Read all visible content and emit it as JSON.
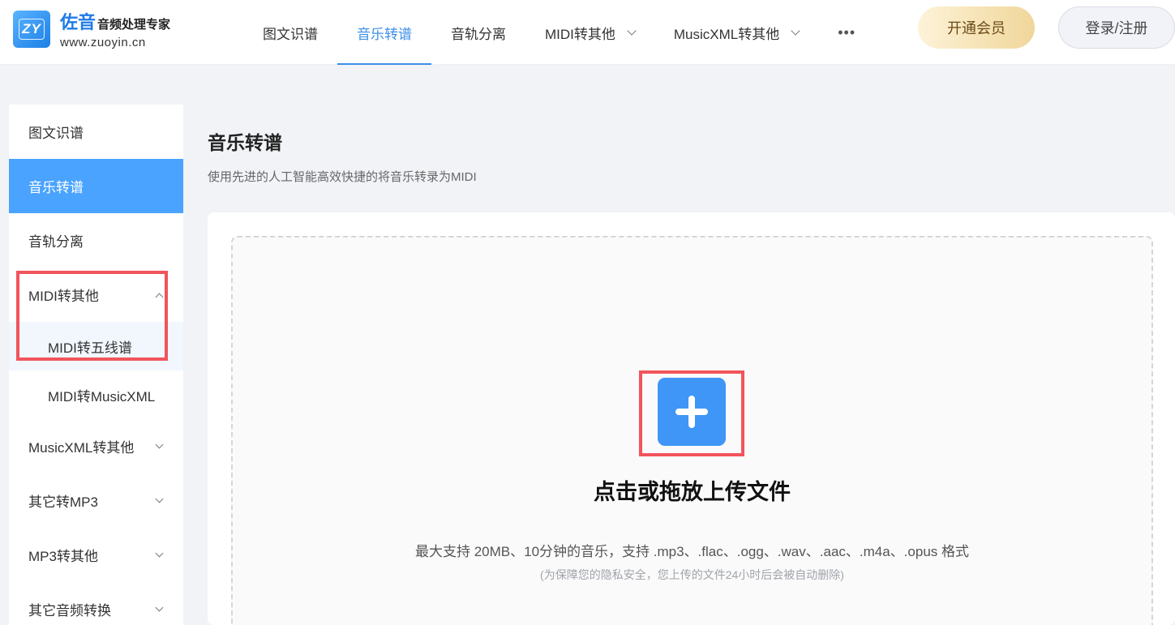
{
  "header": {
    "logo_mark": "ZY",
    "logo_name": "佐音",
    "logo_sub": "音频处理专家",
    "logo_url": "www.zuoyin.cn",
    "nav": [
      {
        "label": "图文识谱"
      },
      {
        "label": "音乐转谱",
        "active": true
      },
      {
        "label": "音轨分离"
      },
      {
        "label": "MIDI转其他",
        "dropdown": true
      },
      {
        "label": "MusicXML转其他",
        "dropdown": true
      },
      {
        "label": "•••"
      }
    ],
    "vip_label": "开通会员",
    "login_label": "登录/注册"
  },
  "sidebar": {
    "items": [
      {
        "label": "图文识谱"
      },
      {
        "label": "音乐转谱",
        "active": true
      },
      {
        "label": "音轨分离"
      },
      {
        "label": "MIDI转其他",
        "expanded": true
      },
      {
        "label": "MIDI转五线谱",
        "sub": true,
        "selected": true
      },
      {
        "label": "MIDI转MusicXML",
        "sub": true
      },
      {
        "label": "MusicXML转其他"
      },
      {
        "label": "其它转MP3"
      },
      {
        "label": "MP3转其他"
      },
      {
        "label": "其它音频转换"
      }
    ]
  },
  "main": {
    "title": "音乐转谱",
    "description": "使用先进的人工智能高效快捷的将音乐转录为MIDI",
    "upload_title": "点击或拖放上传文件",
    "upload_hint": "最大支持 20MB、10分钟的音乐，支持 .mp3、.flac、.ogg、.wav、.aac、.m4a、.opus 格式",
    "upload_note": "(为保障您的隐私安全，您上传的文件24小时后会被自动删除)"
  },
  "colors": {
    "accent": "#3d8ee8",
    "sidebar_active": "#4aa3ff",
    "plus_button": "#3f96f7",
    "highlight_box": "#f2545b"
  }
}
